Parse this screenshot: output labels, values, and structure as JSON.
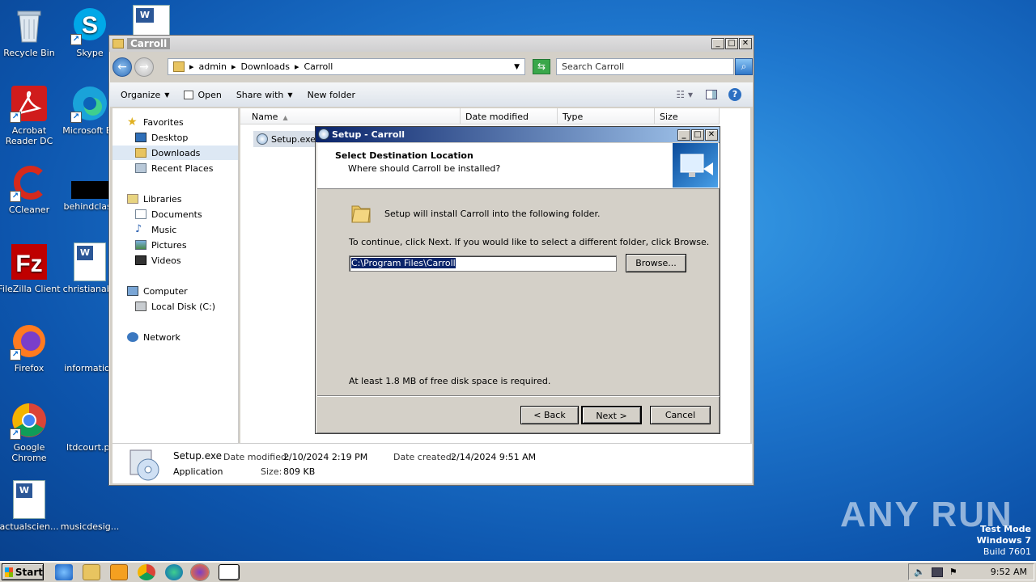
{
  "desktop": {
    "icons": [
      {
        "label": "Recycle Bin",
        "icon": "recycle-bin-icon"
      },
      {
        "label": "Skype",
        "icon": "skype-icon"
      },
      {
        "label": "Acrobat Reader DC",
        "icon": "acrobat-icon"
      },
      {
        "label": "Microsoft Ed",
        "icon": "edge-icon"
      },
      {
        "label": "CCleaner",
        "icon": "ccleaner-icon"
      },
      {
        "label": "behindclass",
        "icon": "blank-file-icon"
      },
      {
        "label": "FileZilla Client",
        "icon": "filezilla-icon"
      },
      {
        "label": "christianabs",
        "icon": "word-doc-icon"
      },
      {
        "label": "Firefox",
        "icon": "firefox-icon"
      },
      {
        "label": "information",
        "icon": "blank-file-icon"
      },
      {
        "label": "Google Chrome",
        "icon": "chrome-icon"
      },
      {
        "label": "ltdcourt.pr",
        "icon": "blank-file-icon"
      },
      {
        "label": "actualscien...",
        "icon": "word-doc-icon"
      },
      {
        "label": "musicdesig...",
        "icon": "blank-file-icon"
      }
    ]
  },
  "explorer": {
    "title": "Carroll",
    "breadcrumb": [
      "admin",
      "Downloads",
      "Carroll"
    ],
    "search_placeholder": "Search Carroll",
    "toolbar": {
      "organize": "Organize",
      "open": "Open",
      "share_with": "Share with",
      "new_folder": "New folder"
    },
    "nav": {
      "favorites": "Favorites",
      "desktop": "Desktop",
      "downloads": "Downloads",
      "recent": "Recent Places",
      "libraries": "Libraries",
      "documents": "Documents",
      "music": "Music",
      "pictures": "Pictures",
      "videos": "Videos",
      "computer": "Computer",
      "local_disk": "Local Disk (C:)",
      "network": "Network"
    },
    "columns": {
      "name": "Name",
      "date": "Date modified",
      "type": "Type",
      "size": "Size"
    },
    "file": "Setup.exe",
    "details": {
      "name": "Setup.exe",
      "type": "Application",
      "date_modified_label": "Date modified:",
      "date_modified": "2/10/2024 2:19 PM",
      "date_created_label": "Date created:",
      "date_created": "2/14/2024 9:51 AM",
      "size_label": "Size:",
      "size": "809 KB"
    }
  },
  "setup": {
    "title": "Setup - Carroll",
    "heading": "Select Destination Location",
    "subheading": "Where should Carroll be installed?",
    "install_text": "Setup will install Carroll into the following folder.",
    "continue_text": "To continue, click Next. If you would like to select a different folder, click Browse.",
    "path": "C:\\Program Files\\Carroll",
    "browse": "Browse...",
    "disk_space": "At least 1.8 MB of free disk space is required.",
    "back": "< Back",
    "next": "Next >",
    "cancel": "Cancel"
  },
  "taskbar": {
    "start": "Start",
    "time": "9:52 AM"
  },
  "watermark": {
    "brand": "ANY RUN",
    "mode": "Test Mode",
    "os": "Windows 7",
    "build": "Build 7601"
  }
}
